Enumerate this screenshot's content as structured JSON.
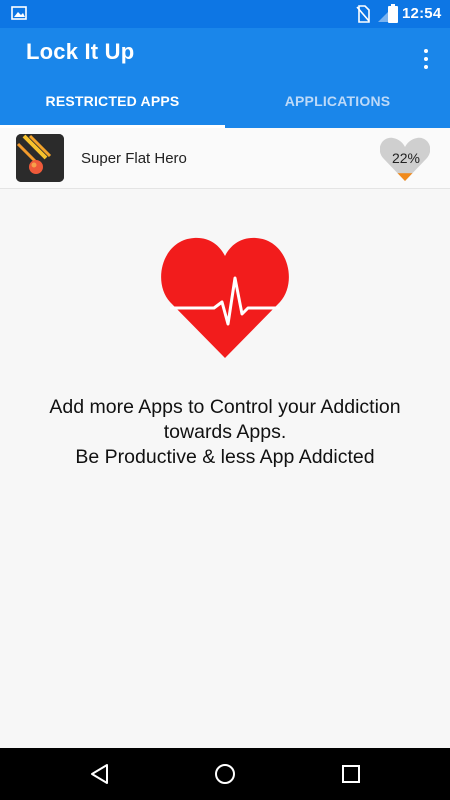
{
  "status_bar": {
    "time": "12:54",
    "icons": [
      "image-notification-icon",
      "no-sim-icon",
      "signal-icon",
      "battery-icon"
    ]
  },
  "app_bar": {
    "title": "Lock It Up",
    "menu_icon": "overflow-menu-icon"
  },
  "tabs": [
    {
      "label": "RESTRICTED APPS",
      "selected": true
    },
    {
      "label": "APPLICATIONS",
      "selected": false
    }
  ],
  "restricted_apps": [
    {
      "name": "Super Flat Hero",
      "usage": "22%",
      "usage_fraction": 0.22
    }
  ],
  "message": {
    "line1": "Add more Apps to Control your Addiction",
    "line2": "towards Apps.",
    "line3": "Be Productive & less App Addicted"
  },
  "colors": {
    "status_bar": "#0d76e4",
    "app_bar": "#1a86ea",
    "heart": "#f21c1c",
    "usage_fill": "#f08a1c",
    "usage_empty": "#cfcfcf"
  },
  "nav_bar": {
    "icons": [
      "back-icon",
      "home-icon",
      "recents-icon"
    ]
  }
}
